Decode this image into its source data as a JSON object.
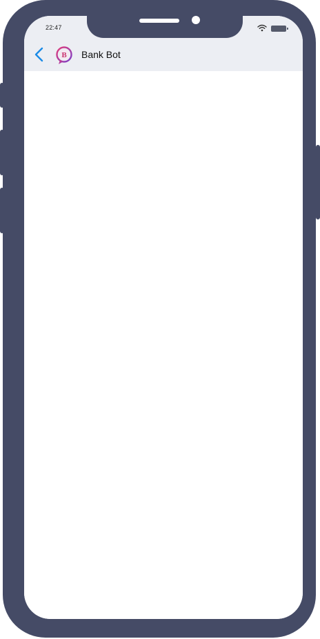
{
  "status_bar": {
    "time": "22:47",
    "wifi_icon": "wifi-icon",
    "battery_icon": "battery-icon"
  },
  "header": {
    "back_icon": "chevron-left-icon",
    "logo_icon": "bank-bot-logo-icon",
    "logo_letter": "B",
    "title": "Bank Bot"
  },
  "colors": {
    "phone_frame": "#454b66",
    "header_bg": "#eceef3",
    "back_arrow": "#1a8be6",
    "logo_gradient_start": "#e23c7a",
    "logo_gradient_end": "#7b3fc8"
  }
}
